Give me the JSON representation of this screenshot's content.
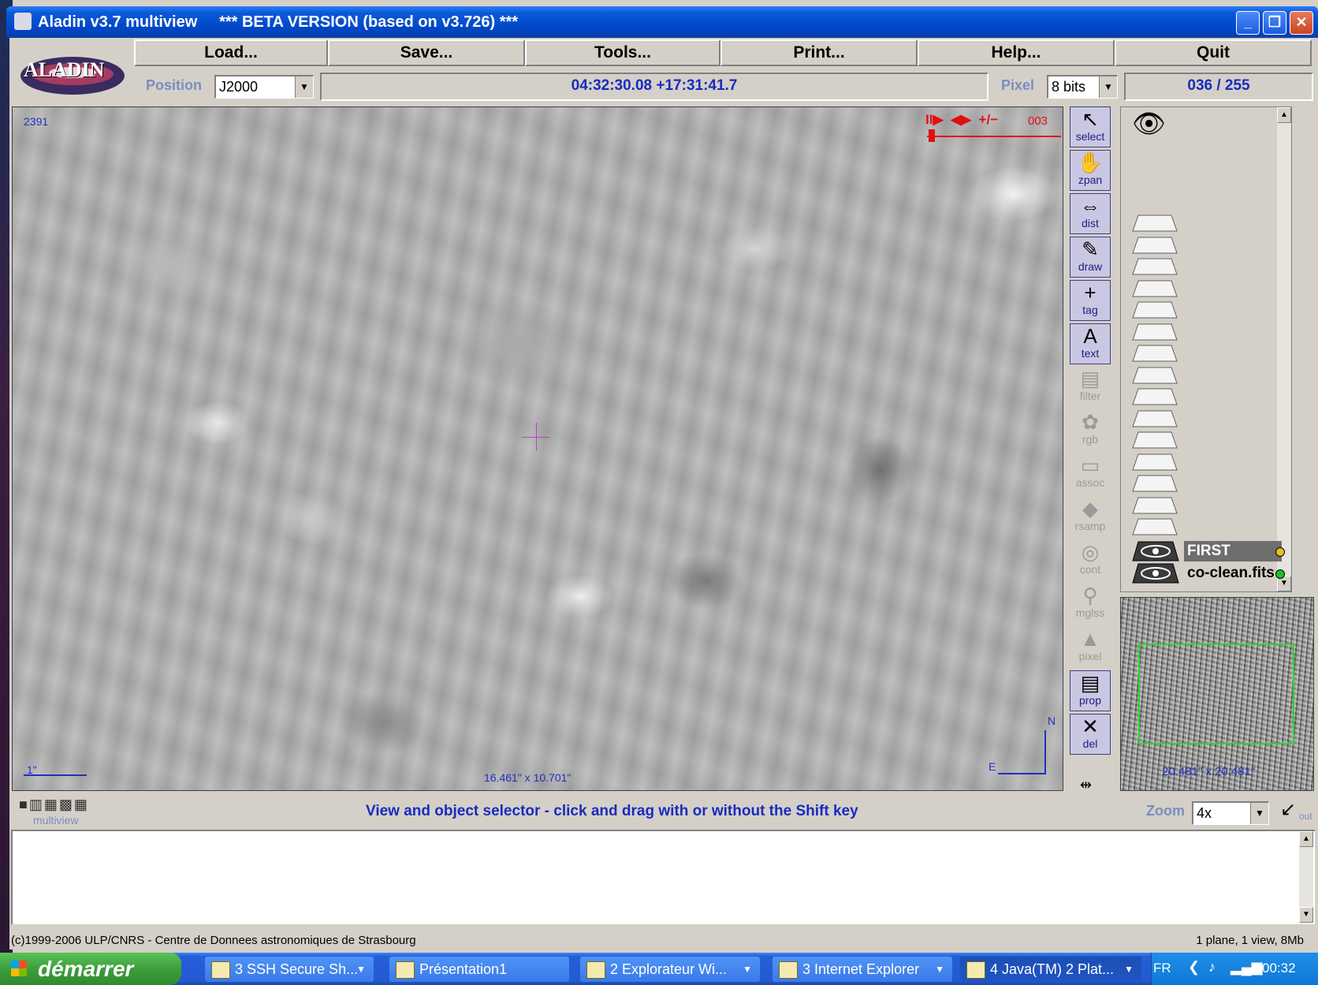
{
  "window": {
    "title": "Aladin v3.7 multiview     *** BETA VERSION (based on v3.726) ***",
    "min": "_",
    "max": "❐",
    "close": "✕"
  },
  "menu": [
    "Load...",
    "Save...",
    "Tools...",
    "Print...",
    "Help...",
    "Quit"
  ],
  "logo_text": "ALADIN",
  "position": {
    "label": "Position",
    "frame": "J2000"
  },
  "coordinates": "04:32:30.08 +17:31:41.7",
  "pixel": {
    "label": "Pixel",
    "mode": "8 bits"
  },
  "pixel_value": "036 / 255",
  "view": {
    "frame_number": "2391",
    "anim_controls": "II▶  ◀▶  +/−",
    "anim_frame": "003",
    "scale_label": "1\"",
    "field_size": "16.461\" x 10.701\"",
    "north": "N",
    "east": "E"
  },
  "tools": [
    {
      "key": "select",
      "label": "select",
      "glyph": "↖",
      "state": "on"
    },
    {
      "key": "zpan",
      "label": "zpan",
      "glyph": "✋",
      "state": "on"
    },
    {
      "key": "dist",
      "label": "dist",
      "glyph": "⇔",
      "state": "on"
    },
    {
      "key": "draw",
      "label": "draw",
      "glyph": "✎",
      "state": "on"
    },
    {
      "key": "tag",
      "label": "tag",
      "glyph": "+",
      "state": "on"
    },
    {
      "key": "text",
      "label": "text",
      "glyph": "A",
      "state": "on"
    },
    {
      "key": "filter",
      "label": "filter",
      "glyph": "▤",
      "state": "off"
    },
    {
      "key": "rgb",
      "label": "rgb",
      "glyph": "✿",
      "state": "off"
    },
    {
      "key": "assoc",
      "label": "assoc",
      "glyph": "▭",
      "state": "off"
    },
    {
      "key": "rsamp",
      "label": "rsamp",
      "glyph": "◆",
      "state": "off"
    },
    {
      "key": "cont",
      "label": "cont",
      "glyph": "◎",
      "state": "off"
    },
    {
      "key": "mglss",
      "label": "mglss",
      "glyph": "⚲",
      "state": "off"
    },
    {
      "key": "pixel",
      "label": "pixel",
      "glyph": "▲",
      "state": "off"
    },
    {
      "key": "prop",
      "label": "prop",
      "glyph": "▤",
      "state": "on"
    },
    {
      "key": "del",
      "label": "del",
      "glyph": "✕",
      "state": "on"
    }
  ],
  "stack": {
    "eye_icon": "eye-icon",
    "planes": [
      {
        "name": "FIRST",
        "dot": "#e8c020",
        "selected": true
      },
      {
        "name": "co-clean.fits",
        "dot": "#20c020",
        "selected": false
      }
    ]
  },
  "zoomview": {
    "size": "20.481\" x 20.481\""
  },
  "multiview_label": "multiview",
  "status": "View and object selector - click and drag with or without the Shift key",
  "zoom": {
    "label": "Zoom",
    "value": "4x",
    "out": "out"
  },
  "footer": {
    "copyright": "(c)1999-2006 ULP/CNRS - Centre de Donnees astronomiques de Strasbourg",
    "info": "1 plane, 1 view, 8Mb"
  },
  "taskbar": {
    "start": "démarrer",
    "tasks": [
      {
        "label": "3 SSH Secure Sh...",
        "drop": true
      },
      {
        "label": "Présentation1",
        "drop": false
      },
      {
        "label": "2 Explorateur Wi...",
        "drop": true
      },
      {
        "label": "3 Internet Explorer",
        "drop": true
      },
      {
        "label": "4 Java(TM) 2 Plat...",
        "drop": true
      }
    ],
    "lang": "FR",
    "clock": "00:32"
  }
}
